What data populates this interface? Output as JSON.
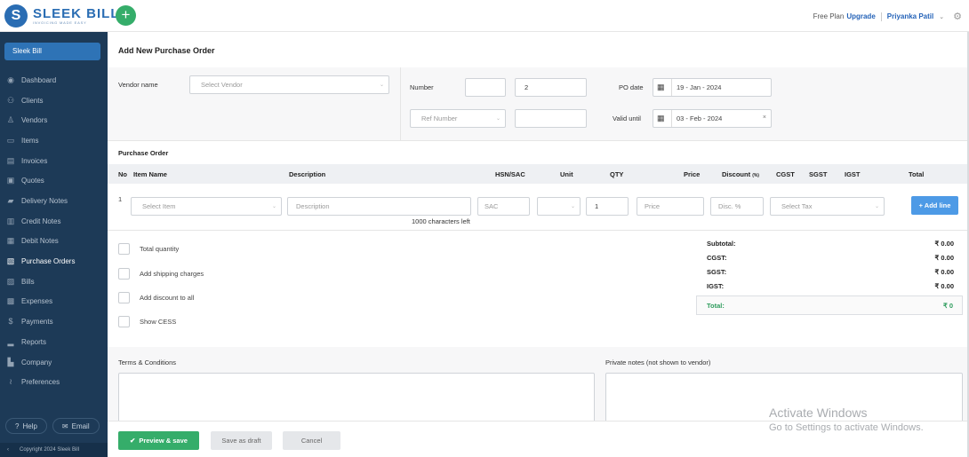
{
  "brand": {
    "logo_letter": "S",
    "name": "SLEEK BILL",
    "tagline": "INVOICING MADE EASY",
    "chip": "Sleek Bill"
  },
  "header": {
    "plan": "Free Plan",
    "upgrade": "Upgrade",
    "user": "Priyanka Patil"
  },
  "sidebar": {
    "items": [
      {
        "label": "Dashboard",
        "icon": "eye-icon"
      },
      {
        "label": "Clients",
        "icon": "clients-icon"
      },
      {
        "label": "Vendors",
        "icon": "vendor-icon"
      },
      {
        "label": "Items",
        "icon": "items-icon"
      },
      {
        "label": "Invoices",
        "icon": "invoice-icon"
      },
      {
        "label": "Quotes",
        "icon": "quote-icon"
      },
      {
        "label": "Delivery Notes",
        "icon": "truck-icon"
      },
      {
        "label": "Credit Notes",
        "icon": "credit-note-icon"
      },
      {
        "label": "Debit Notes",
        "icon": "debit-note-icon"
      },
      {
        "label": "Purchase Orders",
        "icon": "purchase-order-icon"
      },
      {
        "label": "Bills",
        "icon": "bill-icon"
      },
      {
        "label": "Expenses",
        "icon": "expense-icon"
      },
      {
        "label": "Payments",
        "icon": "dollar-icon"
      },
      {
        "label": "Reports",
        "icon": "chart-icon"
      },
      {
        "label": "Company",
        "icon": "company-icon"
      },
      {
        "label": "Preferences",
        "icon": "preferences-icon"
      }
    ],
    "help": "Help",
    "email": "Email",
    "copyright": "Copyright 2024 Sleek Bill"
  },
  "form": {
    "title": "Add New Purchase Order",
    "vendor_label": "Vendor name",
    "vendor_placeholder": "Select Vendor",
    "number_label": "Number",
    "number_prefix": "",
    "number_value": "2",
    "ref_placeholder": "Ref Number",
    "ref_value": "",
    "po_date_label": "PO date",
    "po_date": "19 - Jan - 2024",
    "valid_until_label": "Valid until",
    "valid_until": "03 - Feb - 2024"
  },
  "table": {
    "section": "Purchase Order",
    "headers": {
      "no": "No",
      "item": "Item Name",
      "description": "Description",
      "hsn": "HSN/SAC",
      "unit": "Unit",
      "qty": "QTY",
      "price": "Price",
      "discount": "Discount",
      "discount_unit": "(%)",
      "cgst": "CGST",
      "sgst": "SGST",
      "igst": "IGST",
      "total": "Total"
    },
    "row": {
      "no": "1",
      "item_placeholder": "Select Item",
      "description_placeholder": "Description",
      "sac_placeholder": "SAC",
      "qty": "1",
      "price_placeholder": "Price",
      "discount_placeholder": "Disc. %",
      "tax_placeholder": "Select Tax"
    },
    "chars_left": "1000 characters left",
    "add_line": "+ Add line"
  },
  "options": [
    "Total quantity",
    "Add shipping charges",
    "Add discount to all",
    "Show CESS"
  ],
  "summary": {
    "subtotal_label": "Subtotal:",
    "subtotal": "₹ 0.00",
    "cgst_label": "CGST:",
    "cgst": "₹ 0.00",
    "sgst_label": "SGST:",
    "sgst": "₹ 0.00",
    "igst_label": "IGST:",
    "igst": "₹ 0.00",
    "total_label": "Total:",
    "total": "₹ 0"
  },
  "notes": {
    "terms_label": "Terms & Conditions",
    "private_label": "Private notes (not shown to vendor)"
  },
  "actions": {
    "preview_save": "Preview & save",
    "save_draft": "Save as draft",
    "cancel": "Cancel"
  },
  "watermark": {
    "line1": "Activate Windows",
    "line2": "Go to Settings to activate Windows."
  },
  "colors": {
    "sidebar": "#1d3a57",
    "primary": "#35ad6a",
    "accent": "#2e73b6",
    "add_line": "#4d9ae6"
  }
}
